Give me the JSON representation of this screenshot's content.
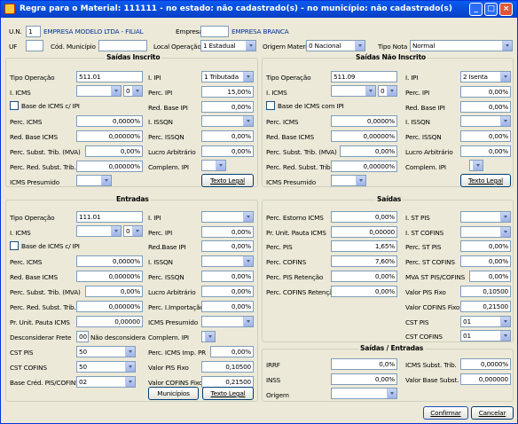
{
  "title": "Regra para o Material: 111111 - no estado: não cadastrado(s) - no município: não cadastrado(s)",
  "header": {
    "un_label": "U.N.",
    "un_value": "1",
    "company": "EMPRESA MODELO LTDA - FILIAL",
    "empresa_label": "Empresa",
    "empresa_name": "EMPRESA BRANCA",
    "uf_label": "UF",
    "cod_mun_label": "Cód. Município",
    "local_op_label": "Local Operação",
    "local_op_value": "1 Estadual",
    "origem_label": "Origem Material",
    "origem_value": "0 Nacional",
    "tipo_nota_label": "Tipo Nota",
    "tipo_nota_value": "Normal"
  },
  "si": {
    "title": "Saídas Inscrito",
    "tipo_op_label": "Tipo Operação",
    "tipo_op_value": "511.01",
    "icms_label": "I. ICMS",
    "icms_sub": "0",
    "base_icms_ipi": "Base de ICMS c/ IPI",
    "perc_icms": "Perc. ICMS",
    "perc_icms_v": "0,0000%",
    "red_base_icms": "Red. Base ICMS",
    "red_base_icms_v": "0,00000%",
    "perc_subst": "Perc. Subst. Trib. (MVA)",
    "perc_subst_v": "0,00%",
    "perc_red_subst": "Perc. Red. Subst. Trib.",
    "perc_red_subst_v": "0,00000%",
    "icms_presumido": "ICMS Presumido",
    "ipi_label": "I. IPI",
    "ipi_value": "1 Tributada",
    "perc_ipi": "Perc. IPI",
    "perc_ipi_v": "15,00%",
    "red_base_ipi": "Red. Base IPI",
    "red_base_ipi_v": "0,00%",
    "issqn": "I. ISSQN",
    "perc_issqn": "Perc. ISSQN",
    "perc_issqn_v": "0,00%",
    "lucro": "Lucro Arbitrário",
    "lucro_v": "0,00%",
    "complem_ipi": "Complem. IPI",
    "texto_legal": "Texto Legal"
  },
  "sni": {
    "title": "Saídas Não Inscrito",
    "tipo_op_label": "Tipo Operação",
    "tipo_op_value": "511.09",
    "icms_label": "I. ICMS",
    "icms_sub": "0",
    "base_icms_ipi": "Base de ICMS com IPI",
    "perc_icms": "Perc. ICMS",
    "perc_icms_v": "0,0000%",
    "red_base_icms": "Red. Base ICMS",
    "red_base_icms_v": "0,00000%",
    "perc_subst": "Perc. Subst. Trib. (MVA)",
    "perc_subst_v": "0,00%",
    "perc_red_subst": "Perc. Red. Subst. Trib.",
    "perc_red_subst_v": "0,00000%",
    "icms_presumido": "ICMS Presumido",
    "ipi_label": "I. IPI",
    "ipi_value": "2 Isenta",
    "perc_ipi": "Perc. IPI",
    "perc_ipi_v": "0,00%",
    "red_base_ipi": "Red. Base IPI",
    "red_base_ipi_v": "0,00%",
    "issqn": "I. ISSQN",
    "perc_issqn": "Perc. ISSQN",
    "perc_issqn_v": "0,00%",
    "lucro": "Lucro Arbitrário",
    "lucro_v": "0,00%",
    "complem_ipi": "Complem. IPI",
    "texto_legal": "Texto Legal"
  },
  "ent": {
    "title": "Entradas",
    "tipo_op_label": "Tipo Operação",
    "tipo_op_value": "111.01",
    "icms_label": "I. ICMS",
    "icms_sub": "0",
    "base_icms_ipi": "Base de ICMS c/ IPI",
    "perc_icms": "Perc. ICMS",
    "perc_icms_v": "0,0000%",
    "red_base_icms": "Red. Base ICMS",
    "red_base_icms_v": "0,00000%",
    "perc_subst": "Perc. Subst. Trib. (MVA)",
    "perc_subst_v": "0,00%",
    "perc_red_subst": "Perc. Red. Subst. Trib.",
    "perc_red_subst_v": "0,00000%",
    "pr_unit": "Pr. Unit. Pauta ICMS",
    "pr_unit_v": "0,00000",
    "desconsiderar": "Desconsiderar Frete",
    "desc_code": "00",
    "desc_text": "Não desconsidera",
    "cst_pis": "CST PIS",
    "cst_pis_v": "50",
    "cst_cofins": "CST COFINS",
    "cst_cofins_v": "50",
    "base_cred": "Base Créd. PIS/COFINS",
    "base_cred_v": "02",
    "ipi": "I. IPI",
    "perc_ipi": "Perc. IPI",
    "perc_ipi_v": "0,00%",
    "red_base_ipi": "Red.Base IPI",
    "red_base_ipi_v": "0,00%",
    "issqn": "I. ISSQN",
    "perc_issqn": "Perc. ISSQN",
    "perc_issqn_v": "0,00%",
    "lucro": "Lucro Arbitrário",
    "lucro_v": "0,00%",
    "perc_imp": "Perc. I.Importação",
    "perc_imp_v": "0,00%",
    "icms_presumido": "ICMS Presumido",
    "complem_ipi": "Complem. IPI",
    "perc_icms_imp": "Perc. ICMS Imp. PR",
    "perc_icms_imp_v": "0,00%",
    "valor_pis": "Valor PIS Fixo",
    "valor_pis_v": "0,10500",
    "valor_cofins": "Valor COFINS Fixo",
    "valor_cofins_v": "0,21500",
    "municipios": "Municípios",
    "texto_legal": "Texto Legal"
  },
  "sai": {
    "title": "Saídas",
    "perc_estorno": "Perc. Estorno ICMS",
    "perc_estorno_v": "0,00%",
    "pr_unit": "Pr. Unit. Pauta ICMS",
    "pr_unit_v": "0,00000",
    "perc_pis": "Perc. PIS",
    "perc_pis_v": "1,65%",
    "perc_cofins": "Perc. COFINS",
    "perc_cofins_v": "7,60%",
    "perc_pis_ret": "Perc. PIS Retenção",
    "perc_pis_ret_v": "0,00%",
    "perc_cofins_ret": "Perc. COFINS Retenção",
    "perc_cofins_ret_v": "0,00%",
    "ist_pis": "I. ST PIS",
    "ist_cofins": "I. ST COFINS",
    "perc_st_pis": "Perc. ST PIS",
    "perc_st_pis_v": "0,00%",
    "perc_st_cofins": "Perc. ST COFINS",
    "perc_st_cofins_v": "0,00%",
    "mva": "MVA ST PIS/COFINS",
    "mva_v": "0,00%",
    "valor_pis": "Valor PIS Fixo",
    "valor_pis_v": "0,10500",
    "valor_cofins": "Valor COFINS Fixo",
    "valor_cofins_v": "0,21500",
    "cst_pis": "CST PIS",
    "cst_pis_v": "01",
    "cst_cofins": "CST COFINS",
    "cst_cofins_v": "01"
  },
  "se": {
    "title": "Saídas / Entradas",
    "irrf": "IRRF",
    "irrf_v": "0,0%",
    "inss": "INSS",
    "inss_v": "0,00%",
    "origem": "Origem",
    "icms_subst": "ICMS Subst. Trib.",
    "icms_subst_v": "0,0000%",
    "valor_base": "Valor Base Subst.",
    "valor_base_v": "0,000000"
  },
  "buttons": {
    "confirmar": "Confirmar",
    "cancelar": "Cancelar"
  }
}
